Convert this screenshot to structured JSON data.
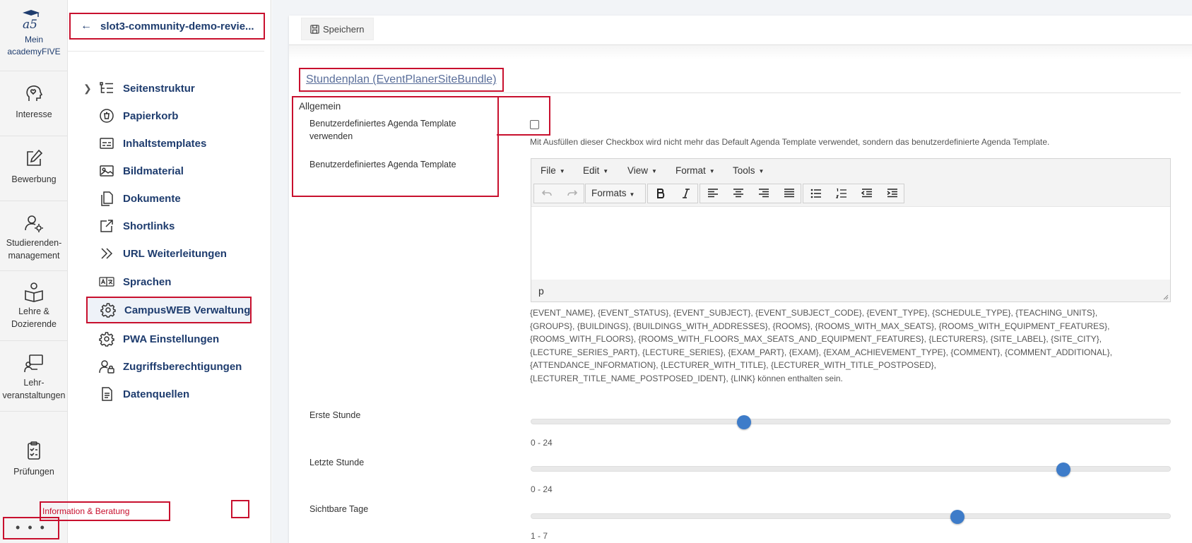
{
  "rail": {
    "brand_line1": "Mein",
    "brand_line2": "academyFIVE",
    "items": [
      {
        "label": "Interesse",
        "icon": "head-heart-icon"
      },
      {
        "label": "Bewerbung",
        "icon": "edit-pencil-icon"
      },
      {
        "label1": "Studierenden-",
        "label2": "management",
        "icon": "user-gear-icon"
      },
      {
        "label1": "Lehre &",
        "label2": "Dozierende",
        "icon": "book-person-icon"
      },
      {
        "label1": "Lehr-",
        "label2": "veranstaltungen",
        "icon": "presentation-icon"
      },
      {
        "label": "Prüfungen",
        "icon": "clipboard-check-icon"
      }
    ],
    "more_label": "• • •"
  },
  "nav": {
    "back_label": "slot3-community-demo-revie...",
    "items": [
      {
        "label": "Seitenstruktur",
        "icon": "tree-list-icon",
        "expandable": true
      },
      {
        "label": "Papierkorb",
        "icon": "trash-icon"
      },
      {
        "label": "Inhaltstemplates",
        "icon": "template-icon"
      },
      {
        "label": "Bildmaterial",
        "icon": "image-icon"
      },
      {
        "label": "Dokumente",
        "icon": "documents-icon"
      },
      {
        "label": "Shortlinks",
        "icon": "external-link-icon"
      },
      {
        "label": "URL Weiterleitungen",
        "icon": "double-chevron-icon"
      },
      {
        "label": "Sprachen",
        "icon": "language-icon"
      },
      {
        "label": "CampusWEB Verwaltung",
        "icon": "gear-icon",
        "active": true
      },
      {
        "label": "PWA Einstellungen",
        "icon": "gear-icon"
      },
      {
        "label": "Zugriffsberechtigungen",
        "icon": "user-lock-icon"
      },
      {
        "label": "Datenquellen",
        "icon": "data-file-icon"
      }
    ],
    "hint_label": "Information & Beratung"
  },
  "toolbar": {
    "save_label": "Speichern"
  },
  "form": {
    "section_title": "Stundenplan (EventPlanerSiteBundle)",
    "group_legend": "Allgemein",
    "checkbox_label_line1": "Benutzerdefiniertes Agenda Template",
    "checkbox_label_line2": "verwenden",
    "checkbox_checked": false,
    "checkbox_help": "Mit Ausfüllen dieser Checkbox wird nicht mehr das Default Agenda Template verwendet, sondern das benutzerdefinierte Agenda Template.",
    "template_label": "Benutzerdefiniertes Agenda Template",
    "editor": {
      "menus": [
        "File",
        "Edit",
        "View",
        "Format",
        "Tools"
      ],
      "formats_label": "Formats",
      "status_path": "p"
    },
    "placeholders_lines": [
      "{EVENT_NAME}, {EVENT_STATUS}, {EVENT_SUBJECT}, {EVENT_SUBJECT_CODE}, {EVENT_TYPE}, {SCHEDULE_TYPE}, {TEACHING_UNITS},",
      "{GROUPS}, {BUILDINGS}, {BUILDINGS_WITH_ADDRESSES}, {ROOMS}, {ROOMS_WITH_MAX_SEATS}, {ROOMS_WITH_EQUIPMENT_FEATURES},",
      "{ROOMS_WITH_FLOORS}, {ROOMS_WITH_FLOORS_MAX_SEATS_AND_EQUIPMENT_FEATURES}, {LECTURERS}, {SITE_LABEL}, {SITE_CITY},",
      "{LECTURE_SERIES_PART}, {LECTURE_SERIES}, {EXAM_PART}, {EXAM}, {EXAM_ACHIEVEMENT_TYPE}, {COMMENT}, {COMMENT_ADDITIONAL},",
      "{ATTENDANCE_INFORMATION}, {LECTURER_WITH_TITLE}, {LECTURER_WITH_TITLE_POSTPOSED},",
      "{LECTURER_TITLE_NAME_POSTPOSED_IDENT}, {LINK} können enthalten sein."
    ],
    "sliders": [
      {
        "label": "Erste Stunde",
        "range": "0 - 24",
        "min": 0,
        "max": 24,
        "value": 8
      },
      {
        "label": "Letzte Stunde",
        "range": "0 - 24",
        "min": 0,
        "max": 24,
        "value": 20
      },
      {
        "label": "Sichtbare Tage",
        "range": "1 - 7",
        "min": 1,
        "max": 7,
        "value": 5
      }
    ]
  },
  "colors": {
    "highlight": "#c8102e",
    "nav_text": "#1e3c6e",
    "slider_thumb": "#3e7cc9"
  }
}
